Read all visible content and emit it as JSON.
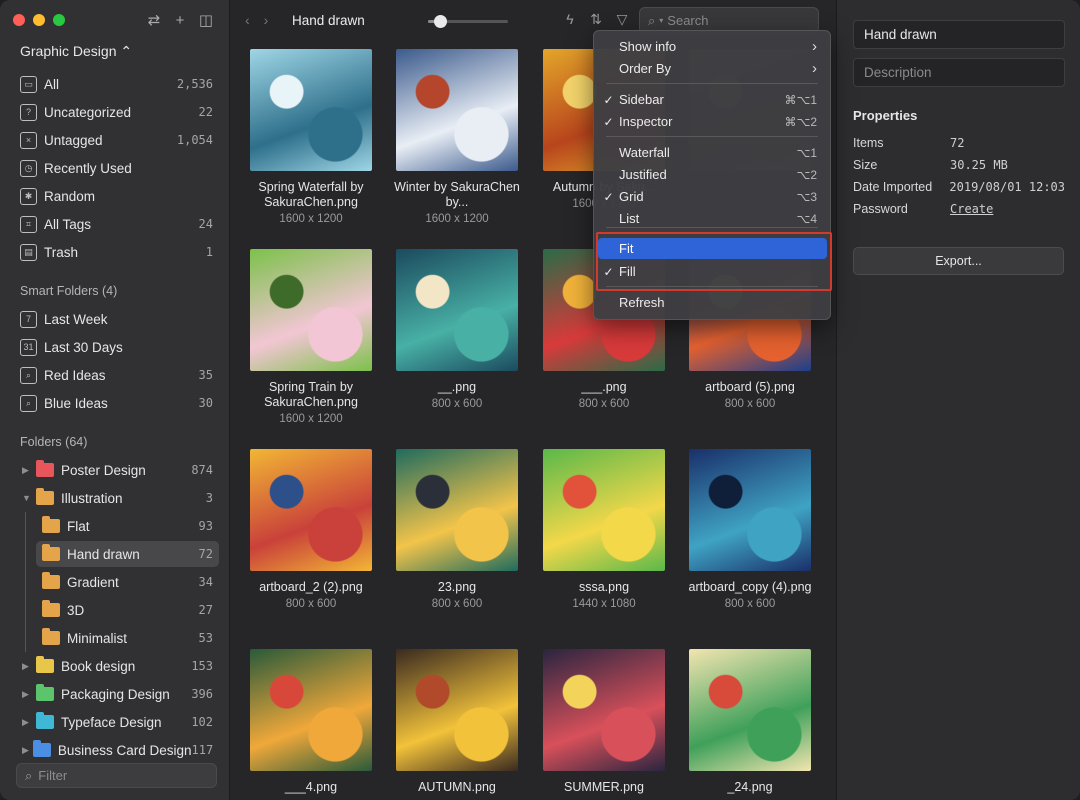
{
  "sidebar": {
    "library": "Graphic Design ⌃",
    "items": [
      {
        "label": "All",
        "count": "2,536",
        "icon": "inbox-icon",
        "glyph": "▭"
      },
      {
        "label": "Uncategorized",
        "count": "22",
        "icon": "question-icon",
        "glyph": "?"
      },
      {
        "label": "Untagged",
        "count": "1,054",
        "icon": "untagged-icon",
        "glyph": "×"
      },
      {
        "label": "Recently Used",
        "count": "",
        "icon": "clock-icon",
        "glyph": "◷"
      },
      {
        "label": "Random",
        "count": "",
        "icon": "lightbulb-icon",
        "glyph": "✱"
      },
      {
        "label": "All Tags",
        "count": "24",
        "icon": "tag-icon",
        "glyph": "⌗"
      },
      {
        "label": "Trash",
        "count": "1",
        "icon": "trash-icon",
        "glyph": "▤"
      }
    ],
    "smart_folders_header": "Smart Folders (4)",
    "smart_folders": [
      {
        "label": "Last Week",
        "count": "",
        "glyph": "7"
      },
      {
        "label": "Last 30 Days",
        "count": "",
        "glyph": "31"
      },
      {
        "label": "Red Ideas",
        "count": "35",
        "glyph": "⌕"
      },
      {
        "label": "Blue Ideas",
        "count": "30",
        "glyph": "⌕"
      }
    ],
    "folders_header": "Folders (64)",
    "folders": [
      {
        "label": "Poster Design",
        "count": "874",
        "color": "#e8555a",
        "chevron": "▶",
        "indent": 0
      },
      {
        "label": "Illustration",
        "count": "3",
        "color": "#e3a44a",
        "chevron": "▼",
        "indent": 0
      },
      {
        "label": "Flat",
        "count": "93",
        "color": "#e3a44a",
        "chevron": "",
        "indent": 1
      },
      {
        "label": "Hand drawn",
        "count": "72",
        "color": "#e3a44a",
        "chevron": "",
        "indent": 1,
        "selected": true
      },
      {
        "label": "Gradient",
        "count": "34",
        "color": "#e3a44a",
        "chevron": "",
        "indent": 1
      },
      {
        "label": "3D",
        "count": "27",
        "color": "#e3a44a",
        "chevron": "",
        "indent": 1
      },
      {
        "label": "Minimalist",
        "count": "53",
        "color": "#e3a44a",
        "chevron": "",
        "indent": 1
      },
      {
        "label": "Book design",
        "count": "153",
        "color": "#e8c64a",
        "chevron": "▶",
        "indent": 0
      },
      {
        "label": "Packaging Design",
        "count": "396",
        "color": "#5cc46a",
        "chevron": "▶",
        "indent": 0
      },
      {
        "label": "Typeface Design",
        "count": "102",
        "color": "#3fb8d6",
        "chevron": "▶",
        "indent": 0
      },
      {
        "label": "Business Card Design",
        "count": "117",
        "color": "#4a8fe3",
        "chevron": "▶",
        "indent": 0
      }
    ],
    "filter_placeholder": "Filter"
  },
  "toolbar": {
    "breadcrumb": "Hand drawn",
    "search_placeholder": "Search",
    "zoom_level": 0.08
  },
  "grid": [
    {
      "name": "Spring Waterfall by SakuraChen.png",
      "size": "1600 x 1200",
      "colors": [
        "#9fd6e6",
        "#2e6f8a",
        "#e8f4f8"
      ]
    },
    {
      "name": "Winter by SakuraChen by...",
      "size": "1600 x 1200",
      "colors": [
        "#3b5a8c",
        "#e9eef5",
        "#b5462c"
      ]
    },
    {
      "name": "Autumn by Saku...",
      "size": "1600 x 1200",
      "colors": [
        "#e3a52a",
        "#b8451d",
        "#f2d36b"
      ]
    },
    {
      "name": "",
      "size": "",
      "colors": [
        "#6a5a4a",
        "#3d3a35",
        "#8a7050"
      ]
    },
    {
      "name": "Spring Train by SakuraChen.png",
      "size": "1600 x 1200",
      "colors": [
        "#7cc14a",
        "#f2c6d4",
        "#3f6b2a"
      ]
    },
    {
      "name": "__.png",
      "size": "800 x 600",
      "colors": [
        "#1b4a5e",
        "#48b0a5",
        "#f3e6c6"
      ]
    },
    {
      "name": "___.png",
      "size": "800 x 600",
      "colors": [
        "#2a6b47",
        "#d83a3a",
        "#f0b23a"
      ]
    },
    {
      "name": "artboard (5).png",
      "size": "800 x 600",
      "colors": [
        "#1d3f8a",
        "#e5612f",
        "#f2d26a"
      ]
    },
    {
      "name": "artboard_2 (2).png",
      "size": "800 x 600",
      "colors": [
        "#f2b635",
        "#c9413a",
        "#2d4f8a"
      ]
    },
    {
      "name": "23.png",
      "size": "800 x 600",
      "colors": [
        "#1f6b5e",
        "#f3c44a",
        "#2a2f3a"
      ]
    },
    {
      "name": "sssa.png",
      "size": "1440 x 1080",
      "colors": [
        "#5ab84a",
        "#f3d84a",
        "#e2523a"
      ]
    },
    {
      "name": "artboard_copy (4).png",
      "size": "800 x 600",
      "colors": [
        "#1a2f6a",
        "#3fa3c4",
        "#0f1f3a"
      ]
    },
    {
      "name": "___4.png",
      "size": "",
      "colors": [
        "#2a5a3a",
        "#f0a83a",
        "#d8483a"
      ]
    },
    {
      "name": "AUTUMN.png",
      "size": "",
      "colors": [
        "#3a2a20",
        "#f2c23a",
        "#b04a2a"
      ]
    },
    {
      "name": "SUMMER.png",
      "size": "",
      "colors": [
        "#2a2540",
        "#d8505a",
        "#f3d35a"
      ]
    },
    {
      "name": "_24.png",
      "size": "",
      "colors": [
        "#f2e5b0",
        "#3fa05a",
        "#d84a3a"
      ]
    }
  ],
  "inspector": {
    "title": "Hand drawn",
    "description_placeholder": "Description",
    "properties_label": "Properties",
    "properties": [
      {
        "key": "Items",
        "value": "72"
      },
      {
        "key": "Size",
        "value": "30.25 MB"
      },
      {
        "key": "Date Imported",
        "value": "2019/08/01 12:03"
      },
      {
        "key": "Password",
        "value": "Create"
      }
    ],
    "export_label": "Export..."
  },
  "menu": {
    "items": [
      {
        "label": "Show info",
        "shortcut": "›",
        "checked": false
      },
      {
        "label": "Order By",
        "shortcut": "›",
        "checked": false
      },
      {
        "separator": true
      },
      {
        "label": "Sidebar",
        "shortcut": "⌘⌥1",
        "checked": true
      },
      {
        "label": "Inspector",
        "shortcut": "⌘⌥2",
        "checked": true
      },
      {
        "separator": true
      },
      {
        "label": "Waterfall",
        "shortcut": "⌥1",
        "checked": false
      },
      {
        "label": "Justified",
        "shortcut": "⌥2",
        "checked": false
      },
      {
        "label": "Grid",
        "shortcut": "⌥3",
        "checked": true
      },
      {
        "label": "List",
        "shortcut": "⌥4",
        "checked": false
      },
      {
        "separator": true
      },
      {
        "label": "Fit",
        "shortcut": "",
        "checked": false,
        "active": true
      },
      {
        "label": "Fill",
        "shortcut": "",
        "checked": true
      },
      {
        "separator": true
      },
      {
        "label": "Refresh",
        "shortcut": "",
        "checked": false
      }
    ]
  },
  "colors": {
    "highlight": "#2f63d8",
    "annotation": "#d33a2e"
  }
}
